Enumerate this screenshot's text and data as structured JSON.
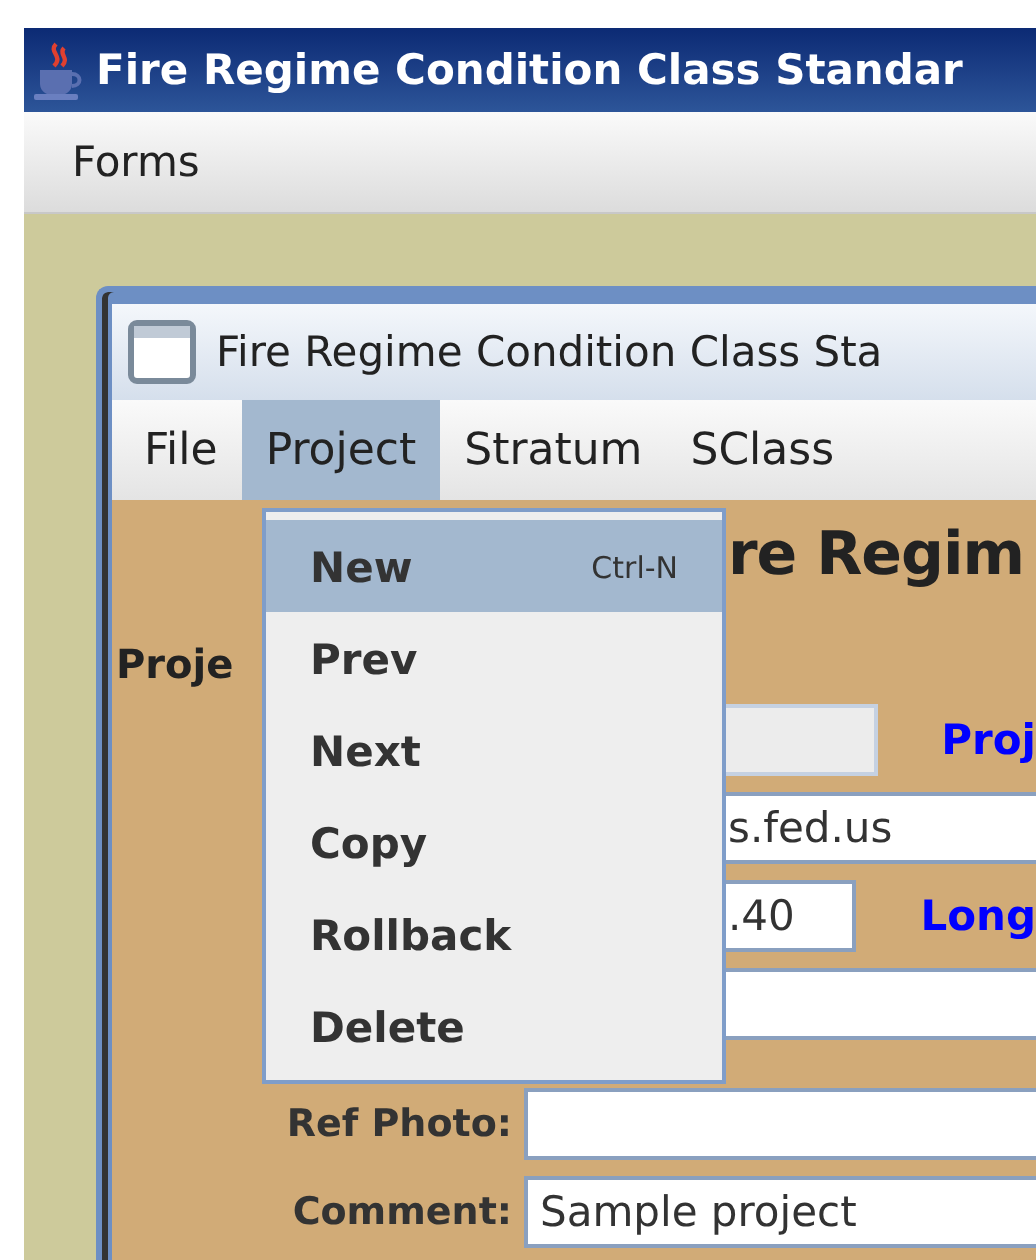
{
  "window": {
    "title": "Fire Regime Condition Class Standar"
  },
  "menubar": [
    {
      "label": "Forms"
    }
  ],
  "inner_window": {
    "title": "Fire Regime Condition Class Sta",
    "menus": [
      {
        "label": "File",
        "selected": false
      },
      {
        "label": "Project",
        "selected": true
      },
      {
        "label": "Stratum",
        "selected": false
      },
      {
        "label": "SClass",
        "selected": false
      }
    ]
  },
  "menu_popup": {
    "items": [
      {
        "label": "New",
        "shortcut": "Ctrl-N",
        "selected": true
      },
      {
        "label": "Prev",
        "selected": false
      },
      {
        "label": "Next",
        "selected": false
      },
      {
        "label": "Copy",
        "selected": false
      },
      {
        "label": "Rollback",
        "selected": false
      },
      {
        "label": "Delete",
        "selected": false
      }
    ]
  },
  "form": {
    "heading": "re Regim",
    "project_label": "Proje",
    "rows": [
      {
        "kind": "short",
        "disabled": true,
        "side_label": "Proj"
      },
      {
        "kind": "wide",
        "disabled": false,
        "value": "s.fed.us"
      },
      {
        "kind": "short",
        "disabled": false,
        "value": ".40",
        "side_label": "Long"
      },
      {
        "kind": "wide",
        "disabled": false
      },
      {
        "kind": "wide",
        "disabled": false,
        "label": "Ref Photo:"
      },
      {
        "kind": "wide",
        "disabled": false,
        "label": "Comment:",
        "value": "Sample project"
      }
    ]
  }
}
